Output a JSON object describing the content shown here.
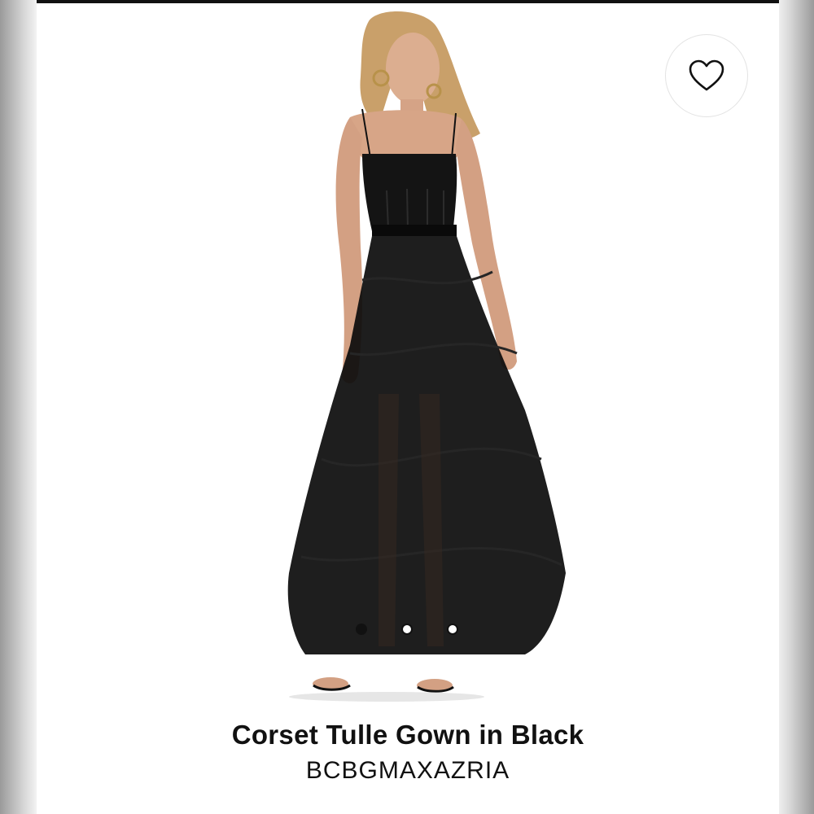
{
  "product": {
    "title": "Corset Tulle Gown in Black",
    "brand": "BCBGMAXAZRIA",
    "image_description_icon": "model-wearing-dress-image"
  },
  "favorite": {
    "icon": "heart-outline-icon",
    "active": false
  },
  "carousel": {
    "count": 3,
    "active_index": 0
  },
  "colors": {
    "text": "#111111",
    "dress": "#0d0d0d",
    "skin": "#d9a98a",
    "hair": "#c9a06a"
  }
}
